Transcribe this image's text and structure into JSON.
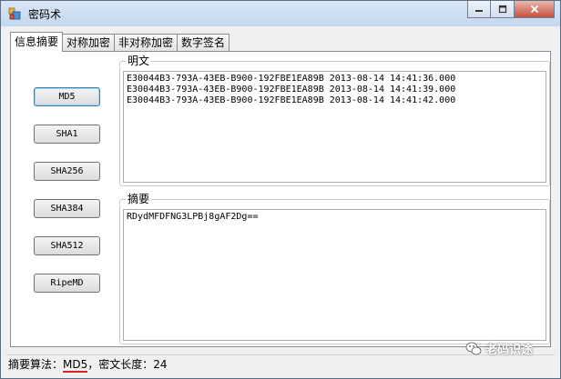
{
  "window": {
    "title": "密码术",
    "minimize_icon": "minimize-icon",
    "maximize_icon": "maximize-icon",
    "close_icon": "close-icon"
  },
  "tabs": [
    {
      "label": "信息摘要",
      "active": true
    },
    {
      "label": "对称加密",
      "active": false
    },
    {
      "label": "非对称加密",
      "active": false
    },
    {
      "label": "数字签名",
      "active": false
    }
  ],
  "buttons": [
    "MD5",
    "SHA1",
    "SHA256",
    "SHA384",
    "SHA512",
    "RipeMD"
  ],
  "plaintext": {
    "label": "明文",
    "value": "E30044B3-793A-43EB-B900-192FBE1EA89B 2013-08-14 14:41:36.000\nE30044B3-793A-43EB-B900-192FBE1EA89B 2013-08-14 14:41:39.000\nE30044B3-793A-43EB-B900-192FBE1EA89B 2013-08-14 14:41:42.000"
  },
  "digest": {
    "label": "摘要",
    "value": "RDydMFDFNG3LPBj8gAF2Dg=="
  },
  "status": {
    "algo_prefix": "摘要算法：",
    "algo_value": "MD5",
    "length_label": "，密文长度：",
    "length_value": "24"
  },
  "watermark": {
    "text": "老码识途",
    "icon": "wechat-icon"
  },
  "colors": {
    "accent": "#3c7fb1",
    "underline": "#e02020"
  }
}
